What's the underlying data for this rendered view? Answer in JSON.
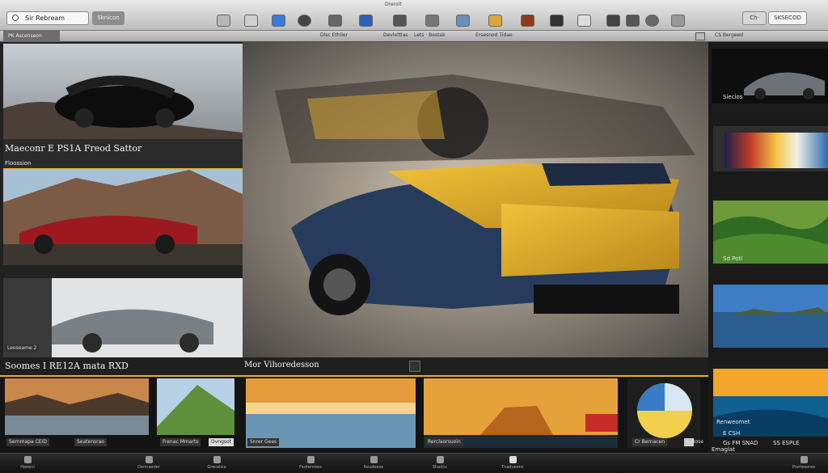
{
  "toolbar": {
    "search_placeholder": "Sir Rebream",
    "button_label": "Sknicon",
    "doc_label": "Dreroit",
    "right_label_1": "Ch·",
    "right_button": "SKSECOD"
  },
  "subbar": {
    "tab_label": "PK Ascenseon",
    "labels": [
      "Disc Ethiler",
      "Devlettlas",
      "Lets · Bestak",
      "Ersesnod Tidae"
    ],
    "right_label": "CS Bergeed"
  },
  "left_panel": {
    "title": "Maeconr E PS1A Freod Sattor",
    "subtitle": "Floossion",
    "third_label": "Leoseame 2"
  },
  "right_panel": {
    "thumb1_label": "Siecios",
    "thumb3_label": "Sd Potl",
    "thumb5_label": "Renweomet",
    "thumb5_caption_1": "E CSH",
    "thumb5_caption_2": "Gs FM SNAD",
    "thumb5_caption_3": "SS ESPLE",
    "thumb5_caption_4": "Emaglat"
  },
  "filmstrip": {
    "left_title": "Soomes I RE12A mata RXD",
    "center_title": "Mor Vihoredesson",
    "captions": [
      "Sernmapa CEID",
      "Seatensrao",
      "Frenac Mmarts",
      "Ovngsot",
      "Snrer Gees",
      "Rerclaorsuoin",
      "Cr Bernacen"
    ],
    "corner_label": "Ir Nose"
  },
  "dock": {
    "items": [
      "Heeenl",
      "Oennaeder",
      "Grecelsia",
      "Feotenrees",
      "Reudeeas",
      "Shadnc",
      "Tnadueenc",
      "Prerieesreo"
    ]
  },
  "colors": {
    "toolbar_top": "#e9e9e9",
    "panel_bg": "#1a1a1a",
    "accent_yellow": "#e6b229",
    "car_blue": "#273b5c"
  }
}
